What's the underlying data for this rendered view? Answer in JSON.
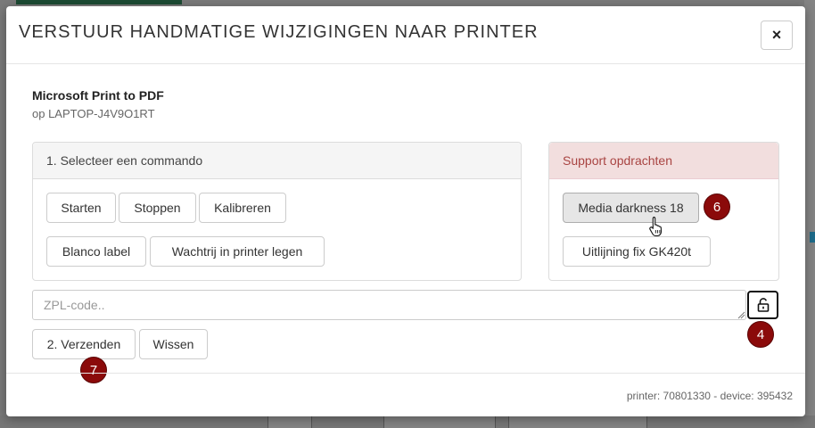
{
  "modal": {
    "title": "VERSTUUR HANDMATIGE WIJZIGINGEN NAAR PRINTER",
    "close_label": "×"
  },
  "printer": {
    "name": "Microsoft Print to PDF",
    "host": "op LAPTOP-J4V9O1RT"
  },
  "command_panel": {
    "heading": "1. Selecteer een commando",
    "buttons": [
      "Starten",
      "Stoppen",
      "Kalibreren",
      "Blanco label",
      "Wachtrij in printer legen"
    ]
  },
  "support_panel": {
    "heading": "Support opdrachten",
    "buttons": [
      "Media darkness 18",
      "Uitlijning fix GK420t"
    ]
  },
  "zpl": {
    "placeholder": "ZPL-code.."
  },
  "actions": {
    "send_label": "2. Verzenden",
    "clear_label": "Wissen"
  },
  "badges": [
    "6",
    "4",
    "7"
  ],
  "footer": {
    "info": "printer: 70801330 - device: 395432"
  },
  "colors": {
    "badge": "#8b0a0a",
    "support_header_bg": "#f2dede",
    "support_header_text": "#a94442"
  },
  "icons": {
    "lock": "unlock-icon",
    "cursor": "hand-pointer-icon"
  }
}
